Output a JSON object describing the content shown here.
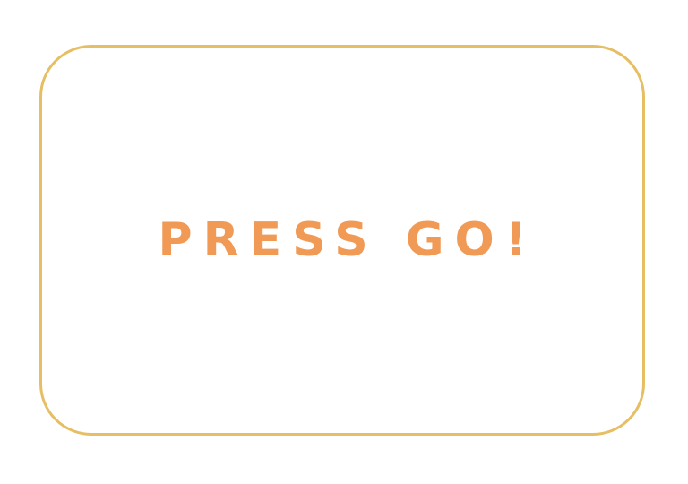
{
  "card": {
    "prompt_text": "PRESS GO!"
  },
  "colors": {
    "border": "#e6bf64",
    "text": "#f09a56",
    "background": "#ffffff"
  }
}
